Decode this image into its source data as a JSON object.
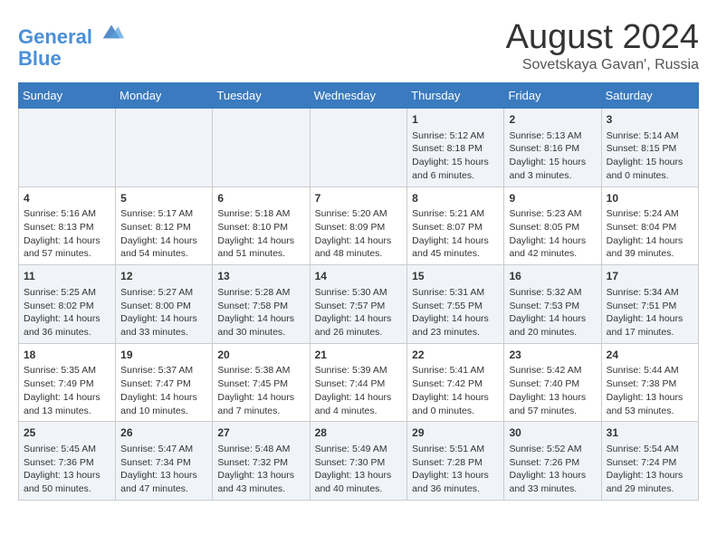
{
  "logo": {
    "line1": "General",
    "line2": "Blue"
  },
  "title": "August 2024",
  "subtitle": "Sovetskaya Gavan', Russia",
  "days_of_week": [
    "Sunday",
    "Monday",
    "Tuesday",
    "Wednesday",
    "Thursday",
    "Friday",
    "Saturday"
  ],
  "weeks": [
    [
      {
        "day": "",
        "content": ""
      },
      {
        "day": "",
        "content": ""
      },
      {
        "day": "",
        "content": ""
      },
      {
        "day": "",
        "content": ""
      },
      {
        "day": "1",
        "content": "Sunrise: 5:12 AM\nSunset: 8:18 PM\nDaylight: 15 hours\nand 6 minutes."
      },
      {
        "day": "2",
        "content": "Sunrise: 5:13 AM\nSunset: 8:16 PM\nDaylight: 15 hours\nand 3 minutes."
      },
      {
        "day": "3",
        "content": "Sunrise: 5:14 AM\nSunset: 8:15 PM\nDaylight: 15 hours\nand 0 minutes."
      }
    ],
    [
      {
        "day": "4",
        "content": "Sunrise: 5:16 AM\nSunset: 8:13 PM\nDaylight: 14 hours\nand 57 minutes."
      },
      {
        "day": "5",
        "content": "Sunrise: 5:17 AM\nSunset: 8:12 PM\nDaylight: 14 hours\nand 54 minutes."
      },
      {
        "day": "6",
        "content": "Sunrise: 5:18 AM\nSunset: 8:10 PM\nDaylight: 14 hours\nand 51 minutes."
      },
      {
        "day": "7",
        "content": "Sunrise: 5:20 AM\nSunset: 8:09 PM\nDaylight: 14 hours\nand 48 minutes."
      },
      {
        "day": "8",
        "content": "Sunrise: 5:21 AM\nSunset: 8:07 PM\nDaylight: 14 hours\nand 45 minutes."
      },
      {
        "day": "9",
        "content": "Sunrise: 5:23 AM\nSunset: 8:05 PM\nDaylight: 14 hours\nand 42 minutes."
      },
      {
        "day": "10",
        "content": "Sunrise: 5:24 AM\nSunset: 8:04 PM\nDaylight: 14 hours\nand 39 minutes."
      }
    ],
    [
      {
        "day": "11",
        "content": "Sunrise: 5:25 AM\nSunset: 8:02 PM\nDaylight: 14 hours\nand 36 minutes."
      },
      {
        "day": "12",
        "content": "Sunrise: 5:27 AM\nSunset: 8:00 PM\nDaylight: 14 hours\nand 33 minutes."
      },
      {
        "day": "13",
        "content": "Sunrise: 5:28 AM\nSunset: 7:58 PM\nDaylight: 14 hours\nand 30 minutes."
      },
      {
        "day": "14",
        "content": "Sunrise: 5:30 AM\nSunset: 7:57 PM\nDaylight: 14 hours\nand 26 minutes."
      },
      {
        "day": "15",
        "content": "Sunrise: 5:31 AM\nSunset: 7:55 PM\nDaylight: 14 hours\nand 23 minutes."
      },
      {
        "day": "16",
        "content": "Sunrise: 5:32 AM\nSunset: 7:53 PM\nDaylight: 14 hours\nand 20 minutes."
      },
      {
        "day": "17",
        "content": "Sunrise: 5:34 AM\nSunset: 7:51 PM\nDaylight: 14 hours\nand 17 minutes."
      }
    ],
    [
      {
        "day": "18",
        "content": "Sunrise: 5:35 AM\nSunset: 7:49 PM\nDaylight: 14 hours\nand 13 minutes."
      },
      {
        "day": "19",
        "content": "Sunrise: 5:37 AM\nSunset: 7:47 PM\nDaylight: 14 hours\nand 10 minutes."
      },
      {
        "day": "20",
        "content": "Sunrise: 5:38 AM\nSunset: 7:45 PM\nDaylight: 14 hours\nand 7 minutes."
      },
      {
        "day": "21",
        "content": "Sunrise: 5:39 AM\nSunset: 7:44 PM\nDaylight: 14 hours\nand 4 minutes."
      },
      {
        "day": "22",
        "content": "Sunrise: 5:41 AM\nSunset: 7:42 PM\nDaylight: 14 hours\nand 0 minutes."
      },
      {
        "day": "23",
        "content": "Sunrise: 5:42 AM\nSunset: 7:40 PM\nDaylight: 13 hours\nand 57 minutes."
      },
      {
        "day": "24",
        "content": "Sunrise: 5:44 AM\nSunset: 7:38 PM\nDaylight: 13 hours\nand 53 minutes."
      }
    ],
    [
      {
        "day": "25",
        "content": "Sunrise: 5:45 AM\nSunset: 7:36 PM\nDaylight: 13 hours\nand 50 minutes."
      },
      {
        "day": "26",
        "content": "Sunrise: 5:47 AM\nSunset: 7:34 PM\nDaylight: 13 hours\nand 47 minutes."
      },
      {
        "day": "27",
        "content": "Sunrise: 5:48 AM\nSunset: 7:32 PM\nDaylight: 13 hours\nand 43 minutes."
      },
      {
        "day": "28",
        "content": "Sunrise: 5:49 AM\nSunset: 7:30 PM\nDaylight: 13 hours\nand 40 minutes."
      },
      {
        "day": "29",
        "content": "Sunrise: 5:51 AM\nSunset: 7:28 PM\nDaylight: 13 hours\nand 36 minutes."
      },
      {
        "day": "30",
        "content": "Sunrise: 5:52 AM\nSunset: 7:26 PM\nDaylight: 13 hours\nand 33 minutes."
      },
      {
        "day": "31",
        "content": "Sunrise: 5:54 AM\nSunset: 7:24 PM\nDaylight: 13 hours\nand 29 minutes."
      }
    ]
  ]
}
